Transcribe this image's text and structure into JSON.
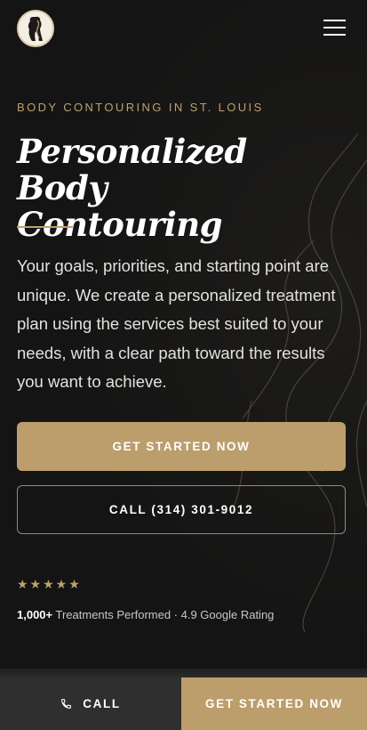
{
  "header": {
    "logo_icon": "silhouette-logo-icon",
    "menu_icon": "hamburger-menu-icon"
  },
  "hero": {
    "eyebrow": "BODY CONTOURING IN ST. LOUIS",
    "title_line1": "Personalized Body",
    "title_line2": "Contouring",
    "lead": "Your goals, priorities, and starting point are unique. We create a personalized treatment plan using the services best suited to your needs, with a clear path toward the results you want to achieve.",
    "primary_cta": "GET STARTED NOW",
    "secondary_cta": "CALL (314) 301-9012"
  },
  "social_proof": {
    "stars": "★★★★★",
    "rating_value": 5,
    "count": "1,000+",
    "text": " Treatments Performed · 4.9 Google Rating"
  },
  "bottom_bar": {
    "call_label": "CALL",
    "call_icon": "phone-icon",
    "start_label": "GET STARTED NOW"
  },
  "colors": {
    "background": "#141414",
    "accent_gold": "#bc9e6c",
    "eyebrow_gold": "#bfa06a",
    "call_bar": "#2f2f2f"
  }
}
